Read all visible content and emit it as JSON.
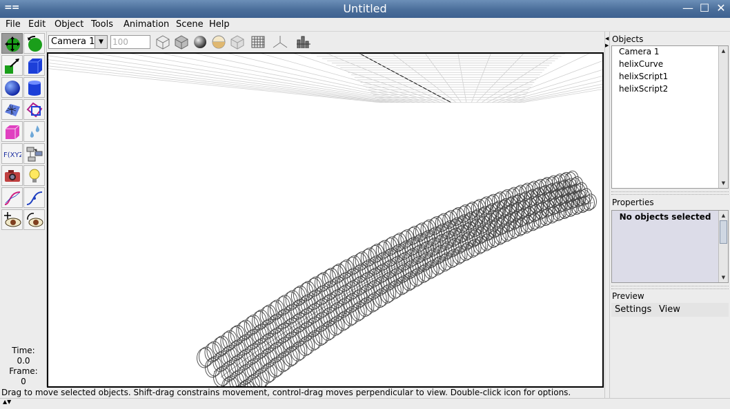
{
  "window": {
    "title": "Untitled",
    "sysmenu": "==",
    "minimize": "—",
    "maximize": "☐",
    "close": "✕"
  },
  "menu": [
    "File",
    "Edit",
    "Object",
    "Tools",
    "Animation",
    "Scene",
    "Help"
  ],
  "tools": [
    "move-tool",
    "rotate-tool",
    "scale-tool",
    "cube-tool",
    "sphere-tool",
    "cylinder-tool",
    "polymesh-tool",
    "skew-tool",
    "pink-cube-tool",
    "droplet-tool",
    "fxyz-tool",
    "tube-tool",
    "camera-tool",
    "light-tool",
    "curve-tool",
    "tube-curve-tool",
    "move-view-tool",
    "rotate-view-tool"
  ],
  "time": {
    "time_label": "Time:",
    "time_value": "0.0",
    "frame_label": "Frame:",
    "frame_value": "0"
  },
  "viewbar": {
    "camera": "Camera 1",
    "scale": "100",
    "buttons": [
      "wireframe-icon",
      "smooth-shaded-icon",
      "sphere-shaded-icon",
      "transparent-icon",
      "textured-icon",
      "grid-icon",
      "axes-icon",
      "template-icon"
    ]
  },
  "objects": {
    "title": "Objects",
    "items": [
      "Camera 1",
      "helixCurve",
      "helixScript1",
      "helixScript2"
    ]
  },
  "properties": {
    "title": "Properties",
    "message": "No objects selected"
  },
  "preview": {
    "title": "Preview",
    "menu": [
      "Settings",
      "View"
    ]
  },
  "status": "Drag to move selected objects.  Shift-drag constrains movement, control-drag moves perpendicular to view.  Double-click icon for options.",
  "colors": {
    "titlebar": "#4a6e9a",
    "viewport_bg": "#ffffff",
    "grid": "#cfcfcf",
    "helix": "#444444",
    "props_bg": "#dcdce8"
  }
}
